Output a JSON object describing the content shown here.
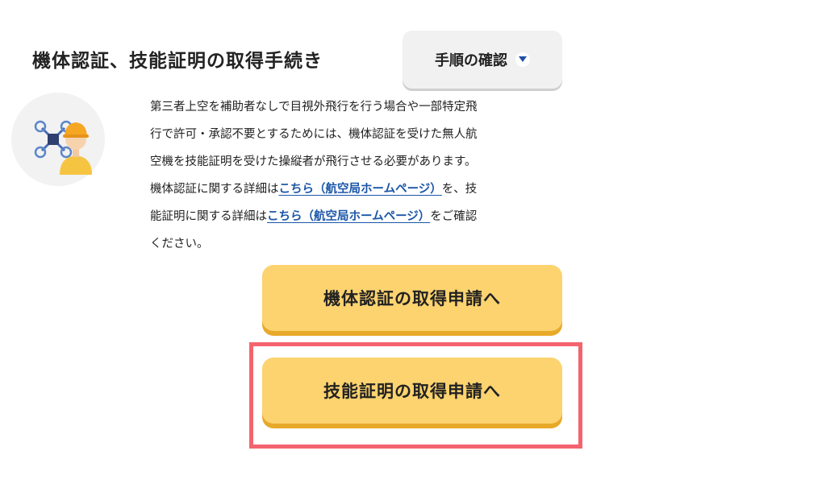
{
  "section": {
    "title": "機体認証、技能証明の取得手続き"
  },
  "procedure_button": {
    "label": "手順の確認",
    "icon": "chevron-down-icon"
  },
  "avatar": {
    "icon": "drone-pilot-icon"
  },
  "description": {
    "line1": "第三者上空を補助者なしで目視外飛行を行う場合や一部特定飛",
    "line2": "行で許可・承認不要とするためには、機体認証を受けた無人航",
    "line3": "空機を技能証明を受けた操縦者が飛行させる必要があります。",
    "line4_pre": "機体認証に関する詳細は",
    "line4_link": "こちら（航空局ホームページ）",
    "line4_post": "を、技",
    "line5_pre": "能証明に関する詳細は",
    "line5_link": "こちら（航空局ホームページ）",
    "line5_post": "をご確認",
    "line6": "ください。"
  },
  "buttons": {
    "airframe_certification": "機体認証の取得申請へ",
    "skill_certification": "技能証明の取得申請へ"
  },
  "colors": {
    "button_yellow": "#fcd36f",
    "button_shadow": "#e8a92a",
    "link_blue": "#1a56a8",
    "highlight_red": "#f4636e",
    "gray_button": "#f1f1f1"
  }
}
